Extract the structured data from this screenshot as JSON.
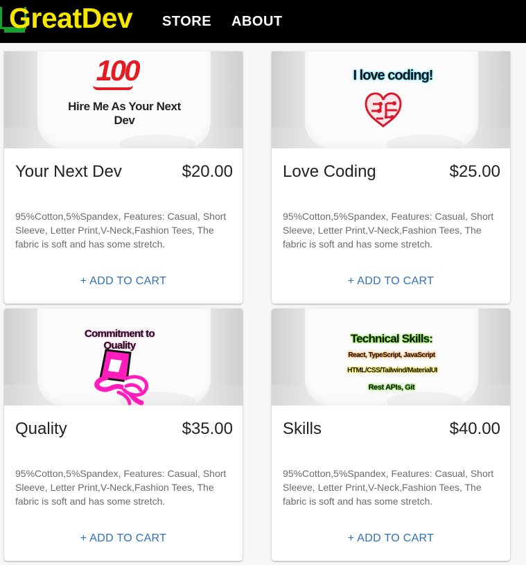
{
  "brand": {
    "name": "GreatDev",
    "text_color": "#f6e600",
    "icon_color": "#16a32e"
  },
  "nav": {
    "items": [
      {
        "label": "STORE"
      },
      {
        "label": "ABOUT"
      }
    ]
  },
  "products": [
    {
      "title": "Your Next Dev",
      "price": "$20.00",
      "description": "95%Cotton,5%Spandex, Features: Casual, Short Sleeve, Letter Print,V-Neck,Fashion Tees, The fabric is soft and has some stretch.",
      "button": "+ ADD TO CART",
      "print_lines": [
        "100",
        "Hire Me As Your Next Dev"
      ]
    },
    {
      "title": "Love Coding",
      "price": "$25.00",
      "description": "95%Cotton,5%Spandex, Features: Casual, Short Sleeve, Letter Print,V-Neck,Fashion Tees, The fabric is soft and has some stretch.",
      "button": "+ ADD TO CART",
      "print_lines": [
        "I love coding!"
      ]
    },
    {
      "title": "Quality",
      "price": "$35.00",
      "description": "95%Cotton,5%Spandex, Features: Casual, Short Sleeve, Letter Print,V-Neck,Fashion Tees, The fabric is soft and has some stretch.",
      "button": "+ ADD TO CART",
      "print_lines": [
        "Commitment to Quality"
      ]
    },
    {
      "title": "Skills",
      "price": "$40.00",
      "description": "95%Cotton,5%Spandex, Features: Casual, Short Sleeve, Letter Print,V-Neck,Fashion Tees, The fabric is soft and has some stretch.",
      "button": "+ ADD TO CART",
      "print_lines": [
        "Technical Skills:",
        "React, TypeScript, JavaScript",
        "HTML/CSS/Tailwind/MaterialUI",
        "Rest APIs, Git"
      ]
    }
  ],
  "colors": {
    "navbar": "#000000",
    "link": "#2f6fb8",
    "price_text": "#222222"
  }
}
